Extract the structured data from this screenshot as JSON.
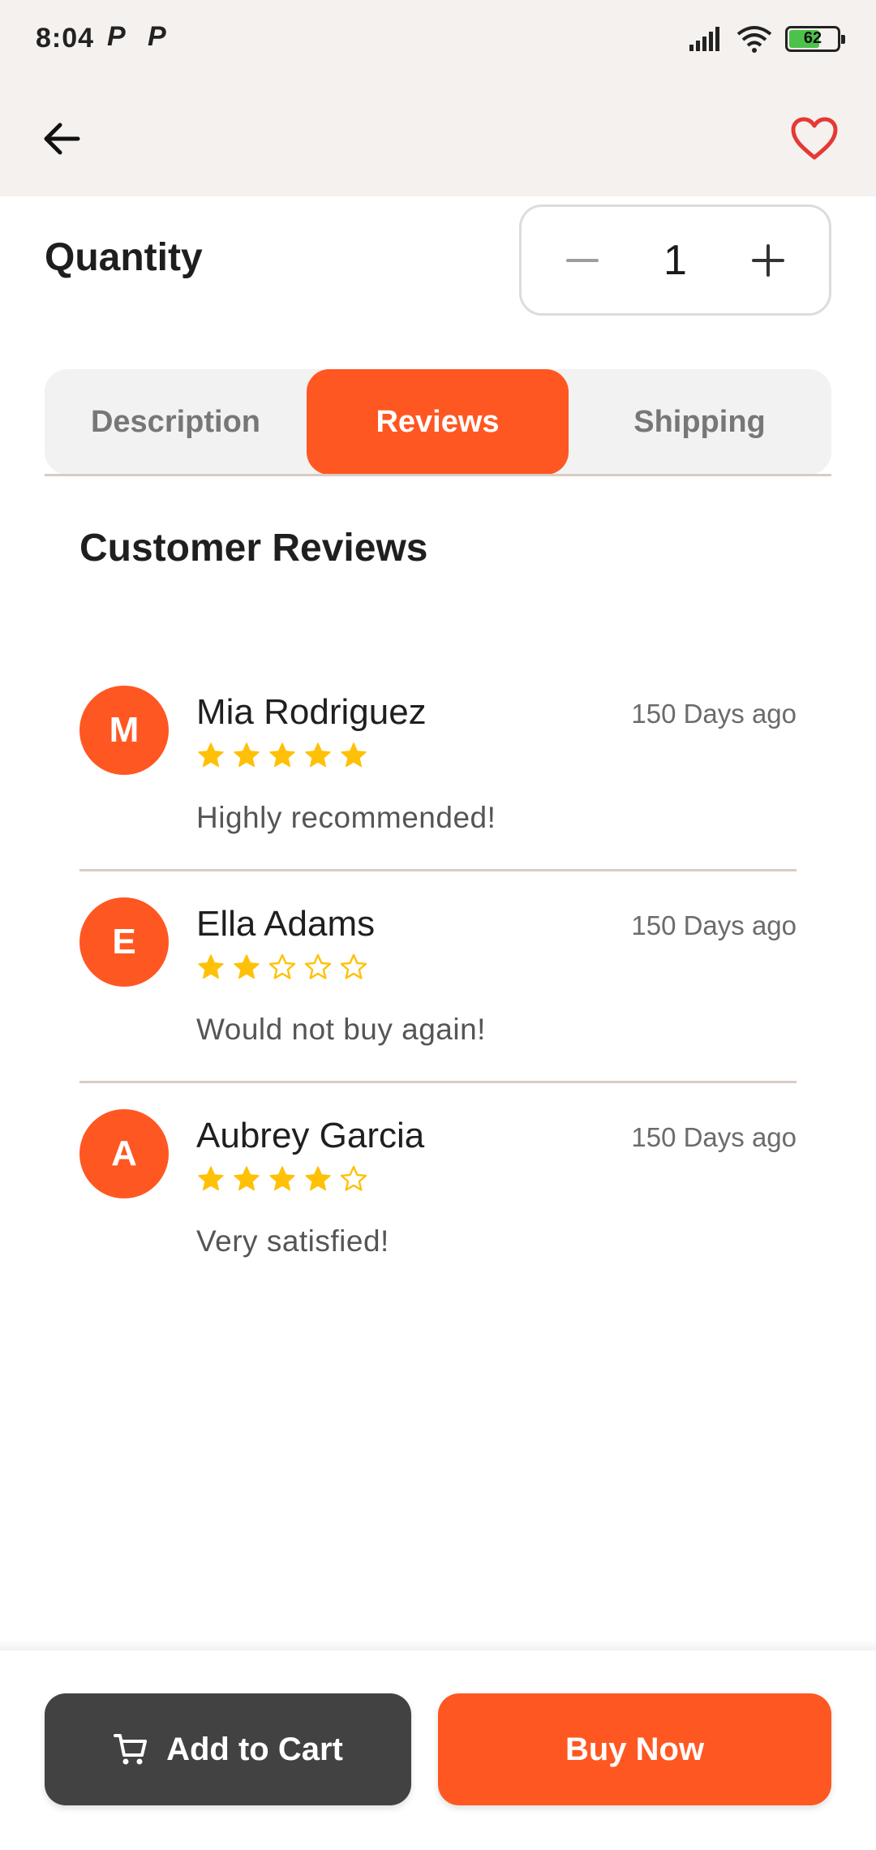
{
  "status_bar": {
    "time": "8:04",
    "notification_icons": [
      "P",
      "P"
    ],
    "battery_level": "62",
    "icons": [
      "signal-icon",
      "wifi-icon",
      "battery-icon"
    ]
  },
  "top_bar": {
    "back_icon": "arrow-left-icon",
    "favorite_icon": "heart-outline-icon"
  },
  "quantity": {
    "label": "Quantity",
    "value": "1",
    "decrement_icon": "minus-icon",
    "increment_icon": "plus-icon"
  },
  "tabs": [
    {
      "label": "Description",
      "active": false
    },
    {
      "label": "Reviews",
      "active": true
    },
    {
      "label": "Shipping",
      "active": false
    }
  ],
  "reviews_section": {
    "title": "Customer Reviews",
    "reviews": [
      {
        "initial": "M",
        "name": "Mia Rodriguez",
        "date": "150 Days ago",
        "rating": 5,
        "text": "Highly recommended!"
      },
      {
        "initial": "E",
        "name": "Ella Adams",
        "date": "150 Days ago",
        "rating": 2,
        "text": "Would not buy again!"
      },
      {
        "initial": "A",
        "name": "Aubrey Garcia",
        "date": "150 Days ago",
        "rating": 4,
        "text": "Very satisfied!"
      }
    ]
  },
  "actions": {
    "add_to_cart_label": "Add to Cart",
    "cart_icon": "cart-icon",
    "buy_now_label": "Buy Now"
  },
  "colors": {
    "accent": "#ff5722",
    "star": "#ffc107",
    "dark_button": "#424242",
    "favorite": "#e53935"
  }
}
